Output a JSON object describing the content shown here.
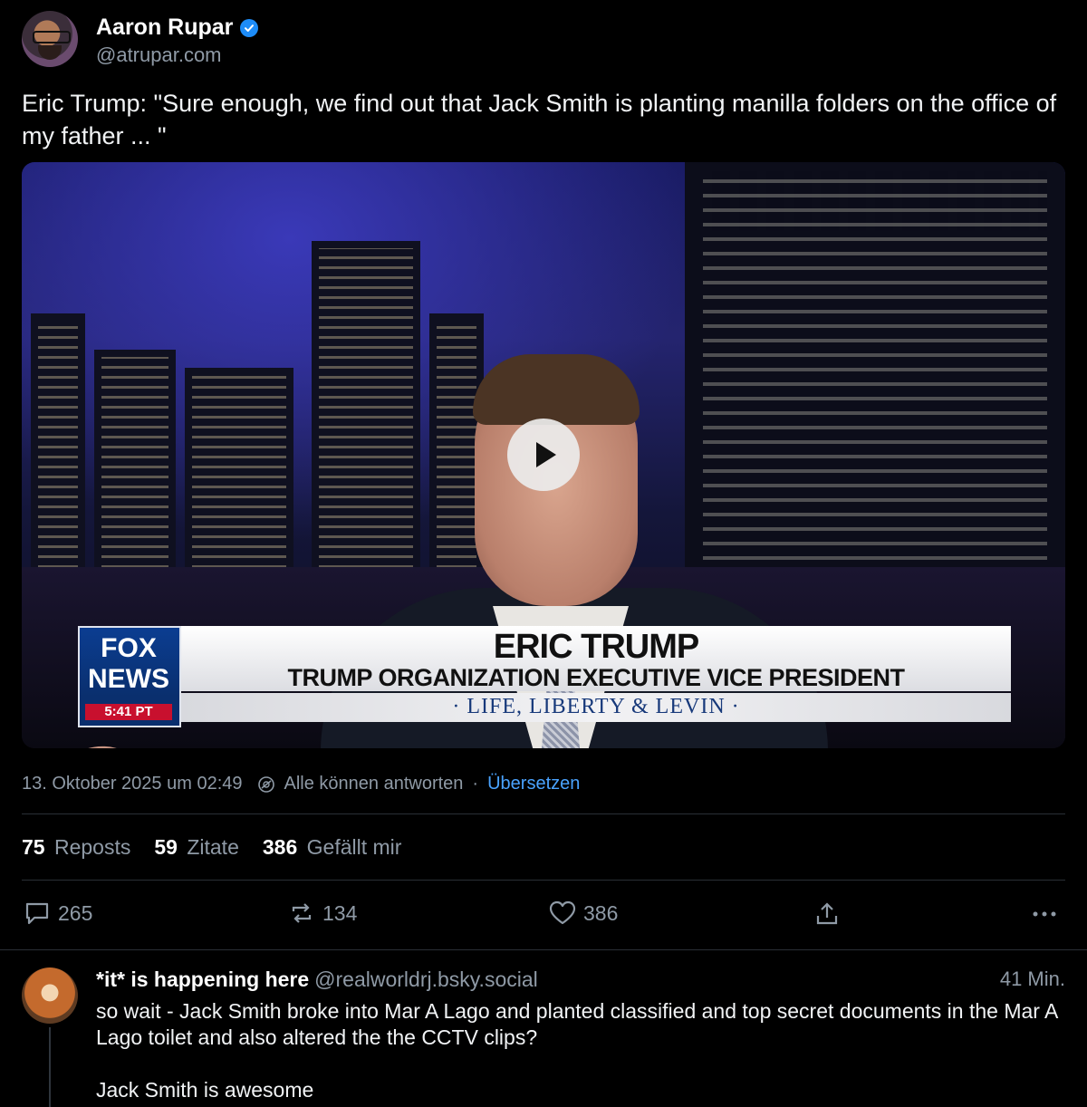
{
  "author": {
    "name": "Aaron Rupar",
    "handle": "@atrupar.com"
  },
  "post": {
    "text": "Eric Trump: \"Sure enough, we find out that Jack Smith is planting manilla folders on the office of my father ... \"",
    "video": {
      "chyron_name": "ERIC TRUMP",
      "chyron_title": "TRUMP ORGANIZATION EXECUTIVE VICE PRESIDENT",
      "show_name": "· LIFE, LIBERTY & LEVIN ·",
      "logo_line1": "FOX",
      "logo_line2": "NEWS",
      "logo_time": "5:41 PT"
    },
    "timestamp": "13. Oktober 2025 um 02:49",
    "reply_setting": "Alle können antworten",
    "translate_label": "Übersetzen"
  },
  "stats": {
    "reposts_count": "75",
    "reposts_label": "Reposts",
    "quotes_count": "59",
    "quotes_label": "Zitate",
    "likes_count": "386",
    "likes_label": "Gefällt mir"
  },
  "actions": {
    "reply_count": "265",
    "repost_count": "134",
    "like_count": "386"
  },
  "reply": {
    "name": "*it* is happening here",
    "handle": "@realworldrj.bsky.social",
    "time": "41 Min.",
    "text": "so wait - Jack Smith broke into Mar A Lago and planted classified and top secret documents in the Mar A Lago toilet and also altered the the CCTV clips?\n\nJack Smith is awesome"
  },
  "colors": {
    "background": "#000000",
    "link": "#4aa3ff",
    "verified": "#1d8cf8",
    "muted_text": "#8f9aa6"
  }
}
